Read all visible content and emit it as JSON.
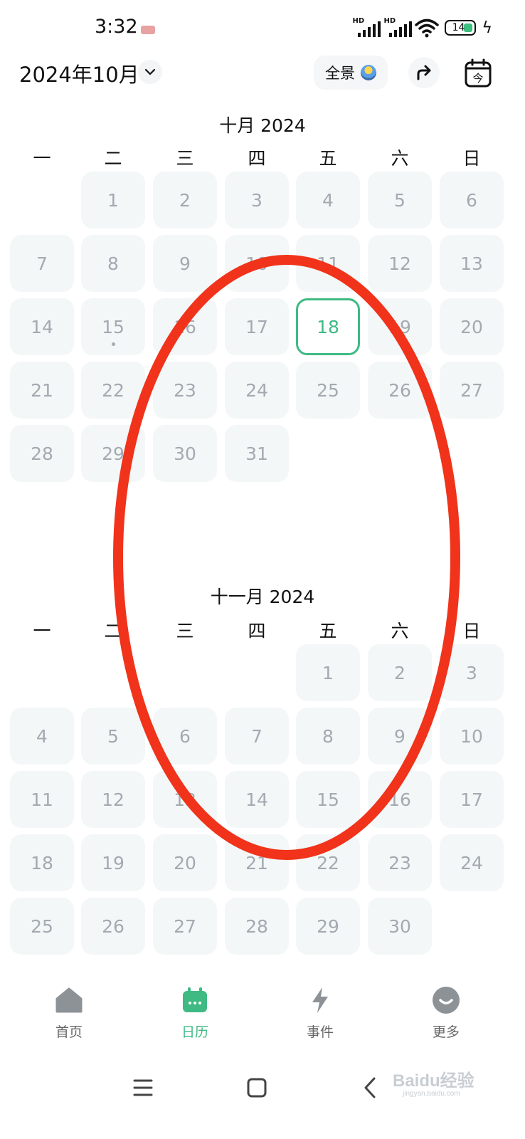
{
  "status_bar": {
    "time": "3:32",
    "signal1_label": "HD",
    "signal2_label": "HD",
    "battery_level": "14",
    "icons": [
      "notification-badge-icon",
      "signal-icon",
      "signal-icon",
      "wifi-icon",
      "battery-icon",
      "charging-bolt-icon"
    ]
  },
  "header": {
    "title": "2024年10月",
    "panorama_label": "全景",
    "share_icon": "share-arrow-icon",
    "today_label": "今"
  },
  "weekdays": [
    "一",
    "二",
    "三",
    "四",
    "五",
    "六",
    "日"
  ],
  "months": [
    {
      "title": "十月 2024",
      "days": [
        "1",
        "2",
        "3",
        "4",
        "5",
        "6",
        "7",
        "8",
        "9",
        "10",
        "11",
        "12",
        "13",
        "14",
        "15",
        "16",
        "17",
        "18",
        "19",
        "20",
        "21",
        "22",
        "23",
        "24",
        "25",
        "26",
        "27",
        "28",
        "29",
        "30",
        "31"
      ],
      "start_weekday_index": 1,
      "today": "18",
      "has_event_dot": [
        "15"
      ]
    },
    {
      "title": "十一月 2024",
      "days": [
        "1",
        "2",
        "3",
        "4",
        "5",
        "6",
        "7",
        "8",
        "9",
        "10",
        "11",
        "12",
        "13",
        "14",
        "15",
        "16",
        "17",
        "18",
        "19",
        "20",
        "21",
        "22",
        "23",
        "24",
        "25",
        "26",
        "27",
        "28",
        "29",
        "30"
      ],
      "start_weekday_index": 4,
      "today": null,
      "has_event_dot": []
    }
  ],
  "annotation": {
    "shape": "ellipse",
    "color": "#f0331a"
  },
  "bottom_nav": {
    "items": [
      {
        "label": "首页",
        "icon": "home-icon",
        "active": false
      },
      {
        "label": "日历",
        "icon": "calendar-icon",
        "active": true
      },
      {
        "label": "事件",
        "icon": "lightning-icon",
        "active": false
      },
      {
        "label": "更多",
        "icon": "more-smile-icon",
        "active": false
      }
    ]
  },
  "system_nav": {
    "icons": [
      "menu-icon",
      "home-square-icon",
      "back-icon"
    ]
  },
  "watermark": {
    "text": "Baidu经验",
    "subtext": "jingyan.baidu.com"
  },
  "colors": {
    "accent": "#3fba83",
    "cell_bg": "#f3f7f8",
    "day_text": "#a3aab0",
    "annotation_red": "#f0331a"
  }
}
